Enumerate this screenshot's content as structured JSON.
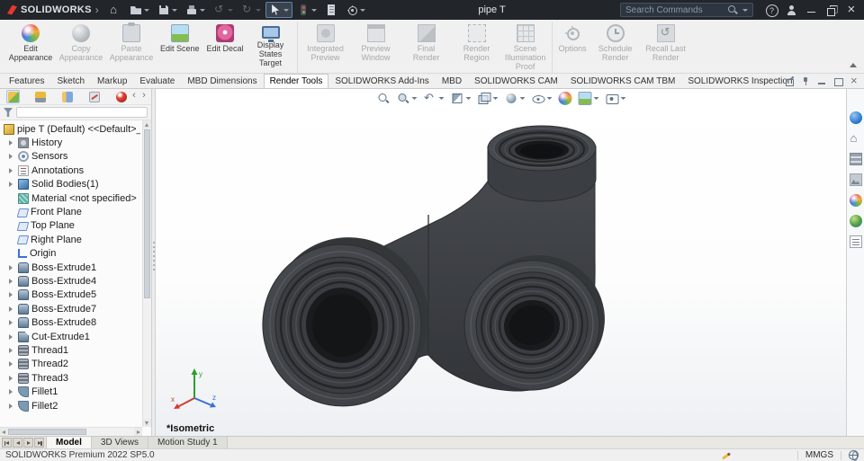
{
  "titlebar": {
    "brand": "SOLIDWORKS",
    "document_title": "pipe T",
    "search_placeholder": "Search Commands",
    "quick_access": [
      {
        "icon": "home-icon"
      },
      {
        "icon": "open-icon",
        "caret": true
      },
      {
        "icon": "save-icon",
        "caret": true
      },
      {
        "icon": "print-icon",
        "caret": true
      },
      {
        "icon": "undo-icon",
        "caret": true,
        "disabled": true
      },
      {
        "icon": "redo-icon",
        "caret": true,
        "disabled": true
      },
      {
        "icon": "select-icon",
        "caret": true,
        "active": true
      },
      {
        "icon": "rebuild-icon",
        "caret": true
      },
      {
        "icon": "file-properties-icon"
      },
      {
        "icon": "options-icon",
        "caret": true
      }
    ],
    "window_controls": [
      {
        "icon": "help-icon"
      },
      {
        "icon": "user-icon"
      },
      {
        "icon": "minimize-icon"
      },
      {
        "icon": "restore-icon"
      },
      {
        "icon": "close-icon"
      }
    ]
  },
  "ribbon": {
    "buttons": [
      {
        "label": "Edit Appearance",
        "icon": "edit-appearance-icon",
        "enabled": true
      },
      {
        "label": "Copy Appearance",
        "icon": "copy-appearance-icon",
        "enabled": false
      },
      {
        "label": "Paste Appearance",
        "icon": "paste-appearance-icon",
        "enabled": false
      },
      {
        "label": "Edit Scene",
        "icon": "edit-scene-icon",
        "enabled": true
      },
      {
        "label": "Edit Decal",
        "icon": "edit-decal-icon",
        "enabled": true
      },
      {
        "label": "Display States Target",
        "icon": "display-states-icon",
        "enabled": true,
        "sep_after": true
      },
      {
        "label": "Integrated Preview",
        "icon": "integrated-preview-icon",
        "enabled": false
      },
      {
        "label": "Preview Window",
        "icon": "preview-window-icon",
        "enabled": false
      },
      {
        "label": "Final Render",
        "icon": "final-render-icon",
        "enabled": false
      },
      {
        "label": "Render Region",
        "icon": "render-region-icon",
        "enabled": false
      },
      {
        "label": "Scene Illumination Proof Sheet",
        "icon": "proof-sheet-icon",
        "enabled": false,
        "sep_after": true
      },
      {
        "label": "Options",
        "icon": "render-options-icon",
        "enabled": false
      },
      {
        "label": "Schedule Render",
        "icon": "schedule-render-icon",
        "enabled": false
      },
      {
        "label": "Recall Last Render",
        "icon": "recall-render-icon",
        "enabled": false
      }
    ]
  },
  "command_tabs": {
    "tabs": [
      {
        "label": "Features"
      },
      {
        "label": "Sketch"
      },
      {
        "label": "Markup"
      },
      {
        "label": "Evaluate"
      },
      {
        "label": "MBD Dimensions"
      },
      {
        "label": "Render Tools",
        "active": true
      },
      {
        "label": "SOLIDWORKS Add-Ins"
      },
      {
        "label": "MBD"
      },
      {
        "label": "SOLIDWORKS CAM"
      },
      {
        "label": "SOLIDWORKS CAM TBM"
      },
      {
        "label": "SOLIDWORKS Inspection"
      }
    ],
    "corner_buttons": [
      {
        "icon": "undock-icon"
      },
      {
        "icon": "pin-icon"
      },
      {
        "icon": "minimize-panel-icon"
      },
      {
        "icon": "restore-panel-icon"
      },
      {
        "icon": "close-panel-icon"
      }
    ]
  },
  "panel": {
    "manager_tabs": [
      {
        "icon": "featuremanager-icon",
        "active": true
      },
      {
        "icon": "propertymanager-icon"
      },
      {
        "icon": "configurationmanager-icon"
      },
      {
        "icon": "dimxpertmanager-icon"
      },
      {
        "icon": "displaymanager-icon"
      }
    ],
    "tree": {
      "root_label": "pipe T (Default) <<Default>_Display S",
      "items": [
        {
          "label": "History",
          "icon": "history-icon"
        },
        {
          "label": "Sensors",
          "icon": "sensors-icon"
        },
        {
          "label": "Annotations",
          "icon": "annotations-icon"
        },
        {
          "label": "Solid Bodies(1)",
          "icon": "solid-bodies-icon"
        },
        {
          "label": "Material <not specified>",
          "icon": "material-icon",
          "expandable": false
        },
        {
          "label": "Front Plane",
          "icon": "plane-icon",
          "expandable": false
        },
        {
          "label": "Top Plane",
          "icon": "plane-icon",
          "expandable": false
        },
        {
          "label": "Right Plane",
          "icon": "plane-icon",
          "expandable": false
        },
        {
          "label": "Origin",
          "icon": "origin-icon",
          "expandable": false
        },
        {
          "label": "Boss-Extrude1",
          "icon": "boss-extrude-icon"
        },
        {
          "label": "Boss-Extrude4",
          "icon": "boss-extrude-icon"
        },
        {
          "label": "Boss-Extrude5",
          "icon": "boss-extrude-icon"
        },
        {
          "label": "Boss-Extrude7",
          "icon": "boss-extrude-icon"
        },
        {
          "label": "Boss-Extrude8",
          "icon": "boss-extrude-icon"
        },
        {
          "label": "Cut-Extrude1",
          "icon": "cut-extrude-icon"
        },
        {
          "label": "Thread1",
          "icon": "thread-icon"
        },
        {
          "label": "Thread2",
          "icon": "thread-icon"
        },
        {
          "label": "Thread3",
          "icon": "thread-icon"
        },
        {
          "label": "Fillet1",
          "icon": "fillet-icon"
        },
        {
          "label": "Fillet2",
          "icon": "fillet-icon"
        }
      ]
    }
  },
  "viewport": {
    "view_label": "*Isometric",
    "headsup": [
      {
        "icon": "zoom-fit-icon"
      },
      {
        "icon": "zoom-area-icon",
        "caret": true
      },
      {
        "icon": "previous-view-icon",
        "caret": true
      },
      {
        "icon": "section-view-icon",
        "caret": true
      },
      {
        "icon": "view-orientation-icon",
        "caret": true
      },
      {
        "icon": "display-style-icon",
        "caret": true
      },
      {
        "icon": "hide-show-icon",
        "caret": true
      },
      {
        "icon": "appearance-ball-icon"
      },
      {
        "icon": "apply-scene-icon",
        "caret": true
      },
      {
        "icon": "view-settings-icon",
        "caret": true
      }
    ],
    "triad_axes": [
      "x",
      "y",
      "z"
    ],
    "triad_colors": {
      "x": "#d23c31",
      "y": "#2ca02c",
      "z": "#3a6fd8"
    }
  },
  "task_pane": [
    {
      "icon": "resources-icon"
    },
    {
      "icon": "design-library-icon"
    },
    {
      "icon": "file-explorer-icon"
    },
    {
      "icon": "view-palette-icon"
    },
    {
      "icon": "appearances-icon"
    },
    {
      "icon": "custom-properties-icon"
    },
    {
      "icon": "forum-icon"
    }
  ],
  "bottom_bar": {
    "nav_buttons": [
      {
        "icon": "tab-first-icon"
      },
      {
        "icon": "tab-prev-icon"
      },
      {
        "icon": "tab-next-icon"
      },
      {
        "icon": "tab-last-icon"
      }
    ],
    "tabs": [
      {
        "label": "Model",
        "active": true
      },
      {
        "label": "3D Views"
      },
      {
        "label": "Motion Study 1"
      }
    ]
  },
  "statusbar": {
    "app_version": "SOLIDWORKS Premium 2022 SP5.0",
    "units": "MMGS"
  }
}
